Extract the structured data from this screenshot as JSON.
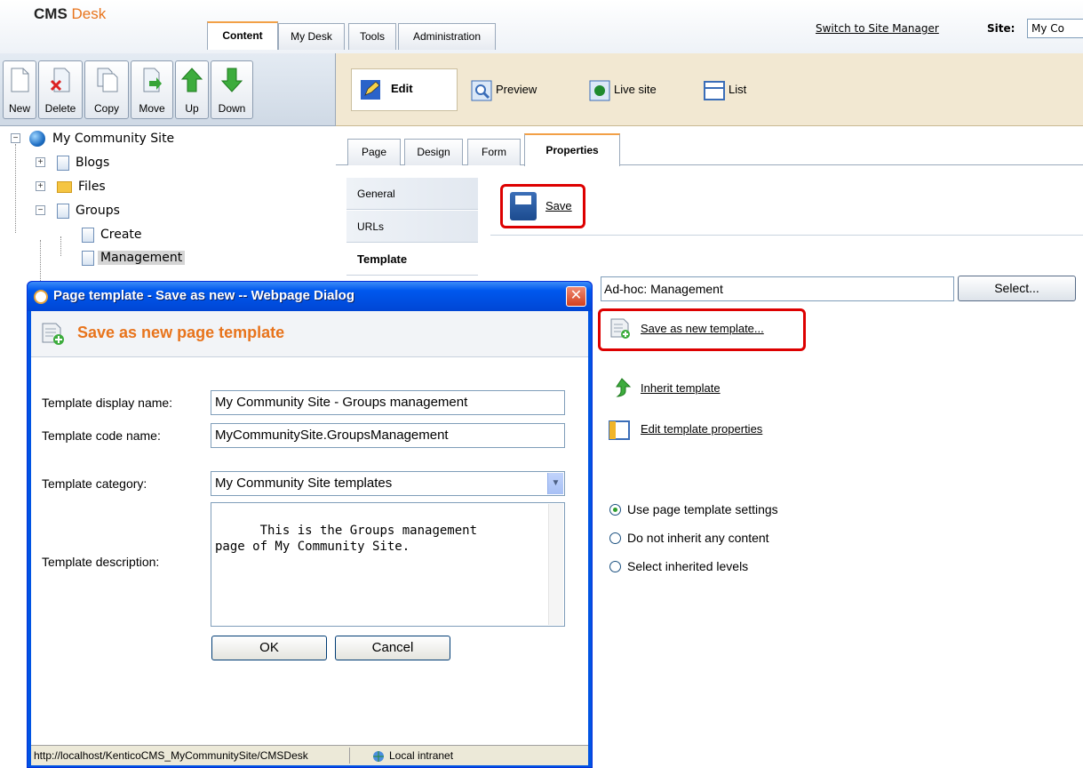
{
  "header": {
    "logo_cms": "CMS",
    "logo_desk": "Desk",
    "tabs": [
      "Content",
      "My Desk",
      "Tools",
      "Administration"
    ],
    "switch_link": "Switch to Site Manager",
    "site_label": "Site:",
    "site_value": "My Co"
  },
  "left_toolbar": {
    "buttons": [
      "New",
      "Delete",
      "Copy",
      "Move",
      "Up",
      "Down"
    ]
  },
  "right_toolbar": {
    "edit": "Edit",
    "preview": "Preview",
    "live_site": "Live site",
    "list": "List"
  },
  "tree": {
    "root": "My Community Site",
    "items": [
      "Blogs",
      "Files",
      "Groups",
      "Create",
      "Management"
    ]
  },
  "doc_tabs": [
    "Page",
    "Design",
    "Form",
    "Properties"
  ],
  "prop_tabs": [
    "General",
    "URLs",
    "Template"
  ],
  "properties": {
    "save": "Save",
    "template_value": "Ad-hoc: Management",
    "select_button": "Select...",
    "save_as_new": "Save as new template...",
    "inherit": "Inherit template",
    "edit_props": "Edit template properties",
    "radios": [
      "Use page template settings",
      "Do not inherit any content",
      "Select inherited levels"
    ]
  },
  "dialog": {
    "title": "Page template - Save as new -- Webpage Dialog",
    "close": "✕",
    "header": "Save as new page template",
    "labels": {
      "display_name": "Template display name:",
      "code_name": "Template code name:",
      "category": "Template category:",
      "description": "Template description:"
    },
    "values": {
      "display_name": "My Community Site - Groups management",
      "code_name": "MyCommunitySite.GroupsManagement",
      "category": "My Community Site templates",
      "description": "This is the Groups management\npage of My Community Site."
    },
    "ok": "OK",
    "cancel": "Cancel",
    "status_url": "http://localhost/KenticoCMS_MyCommunitySite/CMSDesk",
    "status_zone": "Local intranet"
  },
  "colors": {
    "accent_orange": "#e8741c",
    "highlight_red": "#dd0000",
    "dialog_blue": "#0054e3",
    "toolbar_tan": "#f2e8d2"
  }
}
